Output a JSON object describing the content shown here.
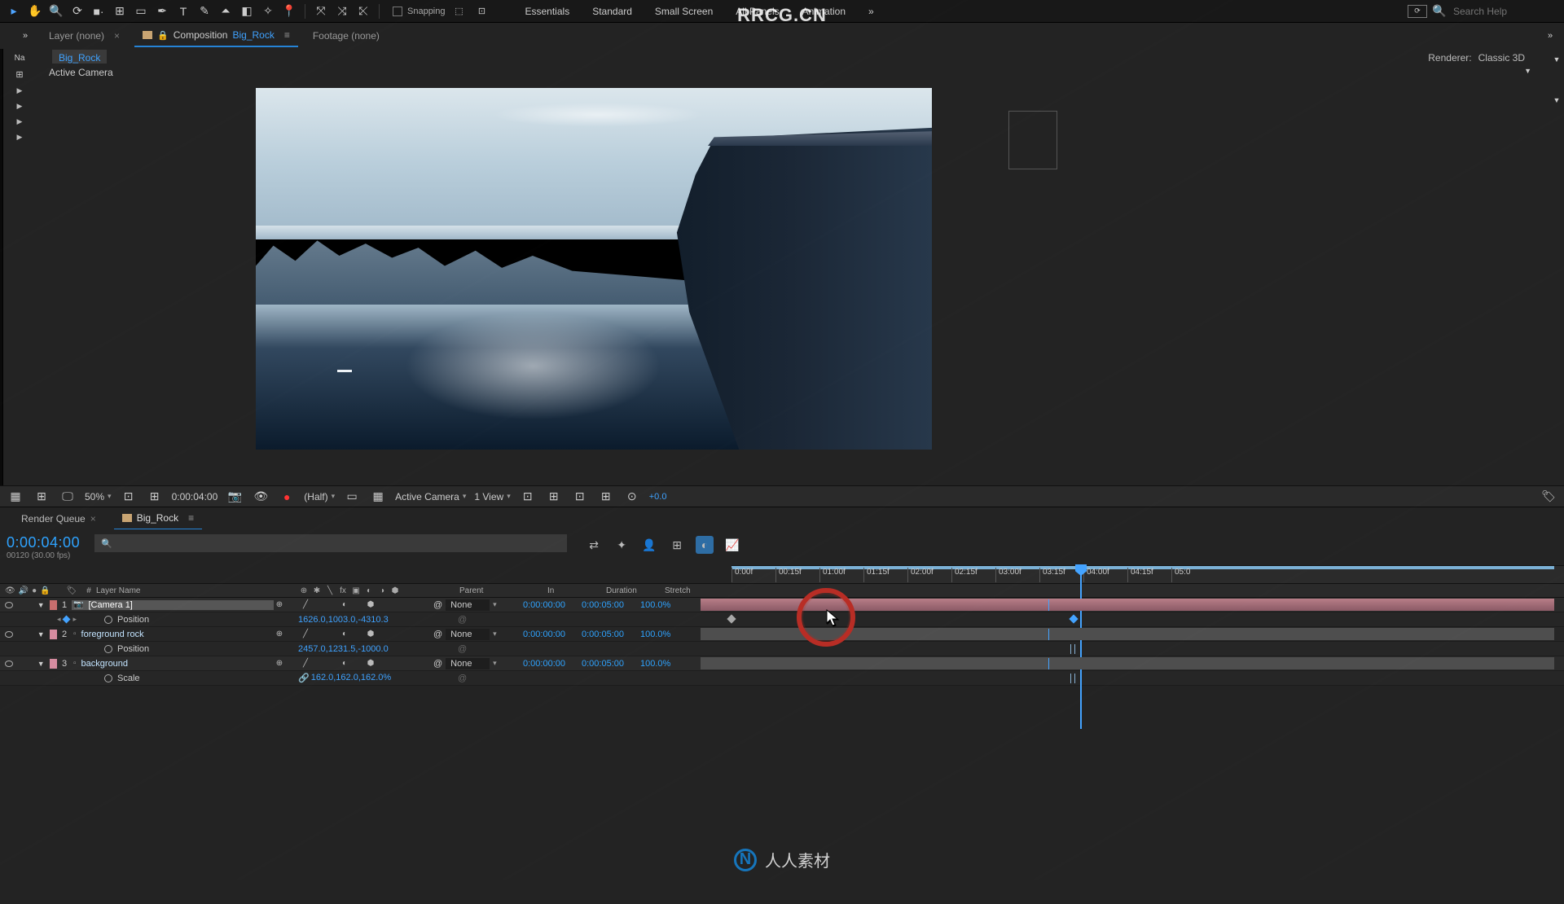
{
  "watermark": {
    "domain": "RRCG.CN",
    "footer": "人人素材"
  },
  "toolbar": {
    "snapping_label": "Snapping",
    "workspaces": [
      "Essentials",
      "Standard",
      "Small Screen",
      "All Panels",
      "Animation"
    ],
    "search_placeholder": "Search Help"
  },
  "panel_tabs": {
    "layer": "Layer (none)",
    "composition_label": "Composition",
    "composition_name": "Big_Rock",
    "footage": "Footage (none)"
  },
  "comp": {
    "crumb": "Big_Rock",
    "active_camera": "Active Camera",
    "renderer_label": "Renderer:",
    "renderer_value": "Classic 3D"
  },
  "viewer_footer": {
    "zoom": "50%",
    "time": "0:00:04:00",
    "resolution": "(Half)",
    "camera": "Active Camera",
    "views": "1 View",
    "exposure": "+0.0"
  },
  "timeline_tabs": {
    "render_queue": "Render Queue",
    "comp_name": "Big_Rock"
  },
  "timeline_header": {
    "timecode": "0:00:04:00",
    "subtime": "00120 (30.00 fps)"
  },
  "ruler_ticks": [
    "0:00f",
    "00:15f",
    "01:00f",
    "01:15f",
    "02:00f",
    "02:15f",
    "03:00f",
    "03:15f",
    "04:00f",
    "04:15f",
    "05:0"
  ],
  "columns": {
    "hash": "#",
    "layer_name": "Layer Name",
    "parent": "Parent",
    "in": "In",
    "duration": "Duration",
    "stretch": "Stretch"
  },
  "layers": [
    {
      "num": "1",
      "name": "Camera 1",
      "type": "camera",
      "selected": true,
      "parent": "None",
      "in": "0:00:00:00",
      "duration": "0:00:05:00",
      "stretch": "100.0%",
      "props": [
        {
          "name": "Position",
          "animated": true,
          "value": "1626.0,1003.0,-4310.3"
        }
      ]
    },
    {
      "num": "2",
      "name": "foreground rock",
      "type": "3d",
      "parent": "None",
      "in": "0:00:00:00",
      "duration": "0:00:05:00",
      "stretch": "100.0%",
      "props": [
        {
          "name": "Position",
          "animated": false,
          "value": "2457.0,1231.5,-1000.0"
        }
      ]
    },
    {
      "num": "3",
      "name": "background",
      "type": "3d",
      "parent": "None",
      "in": "0:00:00:00",
      "duration": "0:00:05:00",
      "stretch": "100.0%",
      "props": [
        {
          "name": "Scale",
          "animated": false,
          "value": "162.0,162.0,162.0%",
          "linked": true
        }
      ]
    }
  ]
}
